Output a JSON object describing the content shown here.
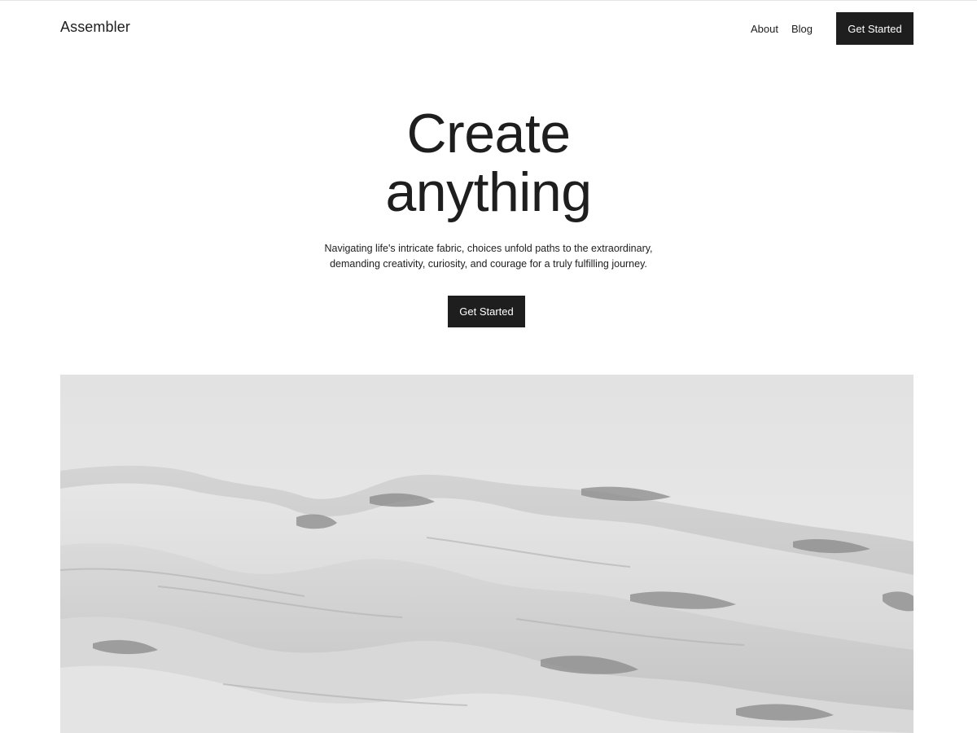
{
  "site": {
    "logo": "Assembler"
  },
  "nav": {
    "items": [
      {
        "label": "About"
      },
      {
        "label": "Blog"
      }
    ],
    "cta_label": "Get Started"
  },
  "hero": {
    "title_line1": "Create",
    "title_line2": "anything",
    "subtitle_line1": "Navigating life's intricate fabric, choices unfold paths to the extraordinary,",
    "subtitle_line2": "demanding creativity, curiosity, and courage for a truly fulfilling journey.",
    "cta_label": "Get Started"
  },
  "colors": {
    "text": "#1e1e1e",
    "button_bg": "#1e1e1e",
    "button_text": "#ffffff",
    "background": "#ffffff"
  }
}
